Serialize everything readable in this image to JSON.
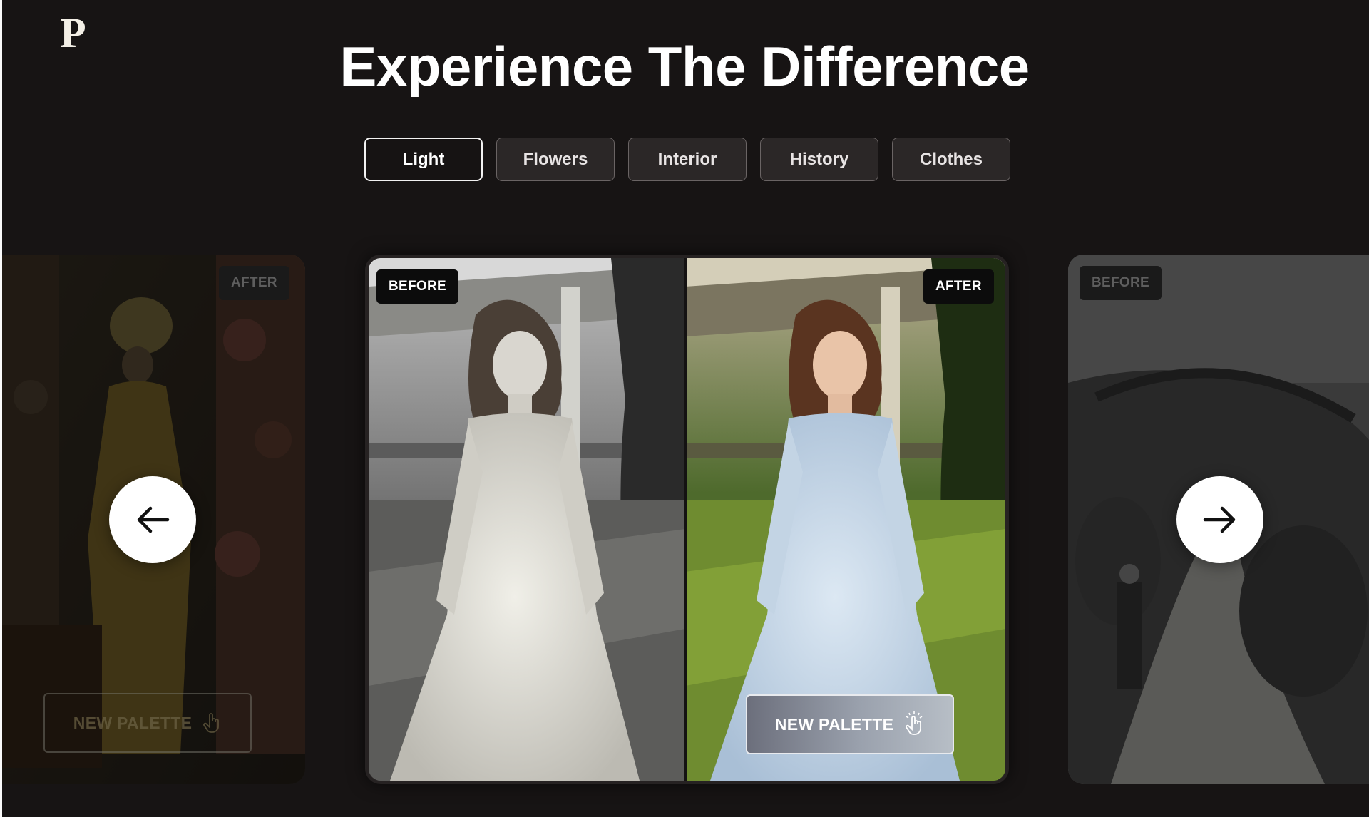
{
  "brand": {
    "logo_letter": "P"
  },
  "header": {
    "title": "Experience The Difference"
  },
  "tabs": [
    {
      "label": "Light",
      "active": true
    },
    {
      "label": "Flowers",
      "active": false
    },
    {
      "label": "Interior",
      "active": false
    },
    {
      "label": "History",
      "active": false
    },
    {
      "label": "Clothes",
      "active": false
    }
  ],
  "carousel": {
    "prev_card": {
      "badge": "AFTER",
      "button_label": "NEW PALETTE"
    },
    "main_card": {
      "before_badge": "BEFORE",
      "after_badge": "AFTER",
      "button_label": "NEW PALETTE"
    },
    "next_card": {
      "badge": "BEFORE"
    },
    "prev_icon": "arrow-left-icon",
    "next_icon": "arrow-right-icon"
  },
  "colors": {
    "background": "#171414",
    "accent": "#ffffff",
    "tab_bg": "#2b2727"
  }
}
